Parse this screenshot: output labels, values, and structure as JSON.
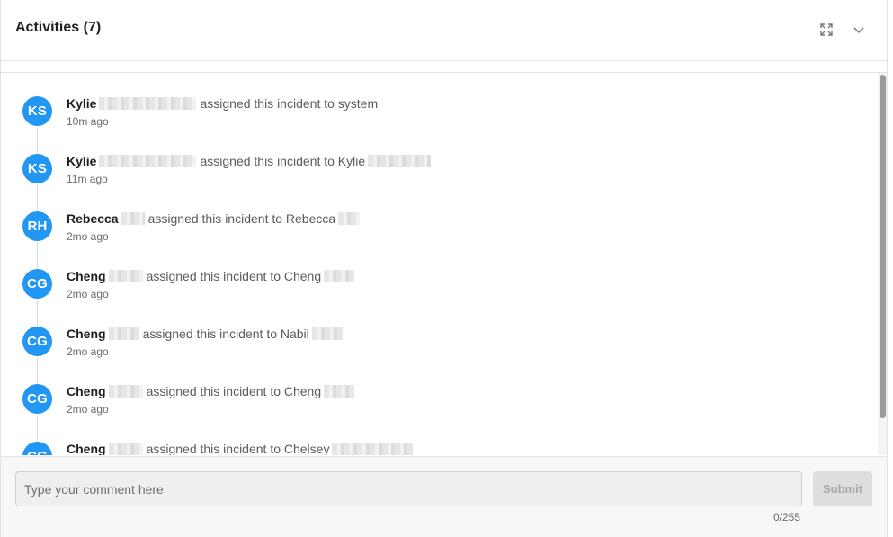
{
  "header": {
    "title": "Activities (7)",
    "expand_icon": "expand-icon",
    "collapse_icon": "chevron-down-icon"
  },
  "colors": {
    "avatar_bg": "#2196f3",
    "submit_bg": "#dedede"
  },
  "activities": [
    {
      "initials": "KS",
      "actor": "Kylie",
      "description": "assigned this incident to system",
      "target_redacted": false,
      "time": "10m ago"
    },
    {
      "initials": "KS",
      "actor": "Kylie",
      "description": "assigned this incident to Kylie",
      "target_redacted": true,
      "time": "11m ago"
    },
    {
      "initials": "RH",
      "actor": "Rebecca",
      "description": "assigned this incident to Rebecca",
      "target_redacted": true,
      "time": "2mo ago"
    },
    {
      "initials": "CG",
      "actor": "Cheng",
      "description": "assigned this incident to Cheng",
      "target_redacted": true,
      "time": "2mo ago"
    },
    {
      "initials": "CG",
      "actor": "Cheng",
      "description": "assigned this incident to Nabil",
      "target_redacted": true,
      "time": "2mo ago"
    },
    {
      "initials": "CG",
      "actor": "Cheng",
      "description": "assigned this incident to Cheng",
      "target_redacted": true,
      "time": "2mo ago"
    },
    {
      "initials": "CG",
      "actor": "Cheng",
      "description": "assigned this incident to Chelsey",
      "target_redacted": true,
      "time": ""
    }
  ],
  "comment": {
    "placeholder": "Type your comment here",
    "value": "",
    "counter": "0/255",
    "submit_label": "Submit"
  }
}
